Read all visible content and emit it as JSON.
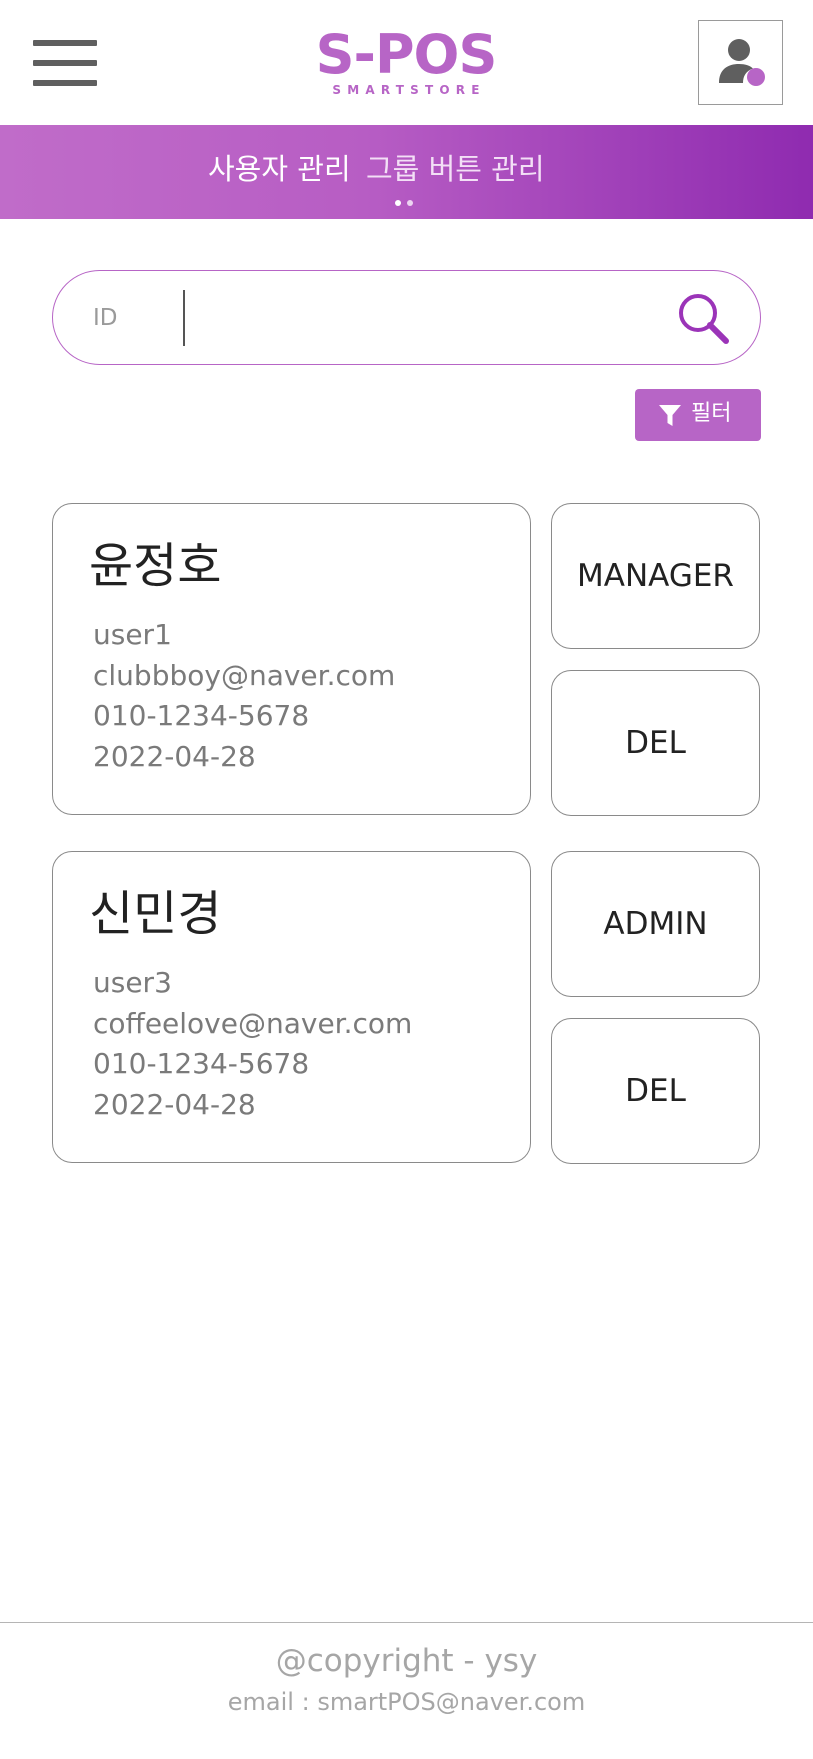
{
  "header": {
    "logo_main": "S-POS",
    "logo_sub": "SMARTSTORE",
    "menu_icon": "hamburger-menu-icon",
    "profile_icon": "user-profile-icon"
  },
  "tabs": {
    "items": [
      {
        "label": "사용자 관리",
        "active": true
      },
      {
        "label": "그룹 버튼 관리",
        "active": false
      }
    ]
  },
  "search": {
    "label": "ID",
    "value": "",
    "placeholder": "",
    "icon": "search-icon"
  },
  "filter": {
    "label": "필터",
    "icon": "filter-icon"
  },
  "users": [
    {
      "name": "윤정호",
      "id": "user1",
      "email": "clubbboy@naver.com",
      "phone": "010-1234-5678",
      "date": "2022-04-28",
      "role_button": "MANAGER",
      "delete_button": "DEL"
    },
    {
      "name": "신민경",
      "id": "user3",
      "email": "coffeelove@naver.com",
      "phone": "010-1234-5678",
      "date": "2022-04-28",
      "role_button": "ADMIN",
      "delete_button": "DEL"
    }
  ],
  "footer": {
    "copyright": "@copyright - ysy",
    "email": "email : smartPOS@naver.com"
  },
  "colors": {
    "brand": "#b765c6",
    "banner_end": "#8f2bb0",
    "border": "#8a8a8a",
    "muted_text": "#7a7a7a"
  }
}
